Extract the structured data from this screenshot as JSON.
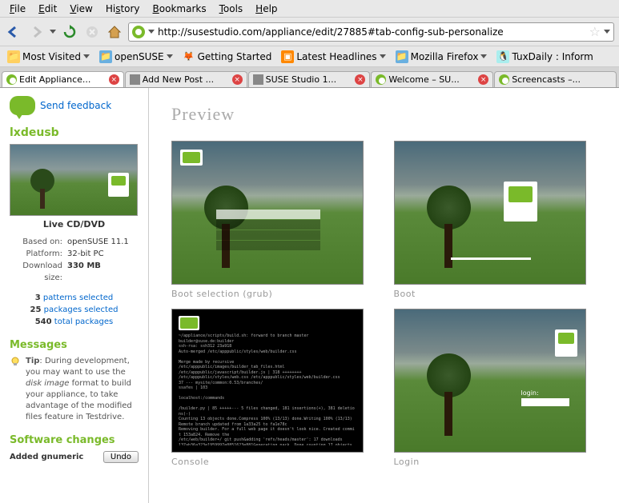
{
  "menu": {
    "file": "File",
    "edit": "Edit",
    "view": "View",
    "history": "History",
    "bookmarks": "Bookmarks",
    "tools": "Tools",
    "help": "Help"
  },
  "url": "http://susestudio.com/appliance/edit/27885#tab-config-sub-personalize",
  "bookmarks": {
    "most_visited": "Most Visited",
    "opensuse": "openSUSE",
    "getting_started": "Getting Started",
    "latest_headlines": "Latest Headlines",
    "mozilla_firefox": "Mozilla Firefox",
    "tuxdaily": "TuxDaily : Inform"
  },
  "tabs": {
    "t0": "Edit Appliance...",
    "t1": "Add New Post ...",
    "t2": "SUSE Studio 1...",
    "t3": "Welcome – SU...",
    "t4": "Screencasts –..."
  },
  "sidebar": {
    "feedback": "Send feedback",
    "appname": "lxdeusb",
    "format": "Live CD/DVD",
    "based_label": "Based on:",
    "based_val": "openSUSE 11.1",
    "platform_label": "Platform:",
    "platform_val": "32-bit PC",
    "download_label": "Download size:",
    "download_val": "330 MB",
    "patterns_n": "3",
    "patterns": "patterns selected",
    "packages_n": "25",
    "packages": "packages selected",
    "total_n": "540",
    "total": "total packages",
    "messages_h": "Messages",
    "tip_label": "Tip",
    "tip_text": ": During development, you may want to use the ",
    "tip_em": "disk image",
    "tip_text2": " format to build your appliance, to take advantage of the modified files feature in Testdrive.",
    "changes_h": "Software changes",
    "change1": "Added gnumeric",
    "undo": "Undo"
  },
  "main": {
    "preview": "Preview",
    "cap_boot_sel": "Boot selection (grub)",
    "cap_boot": "Boot",
    "cap_console": "Console",
    "cap_login": "Login",
    "login_label": "login:"
  }
}
